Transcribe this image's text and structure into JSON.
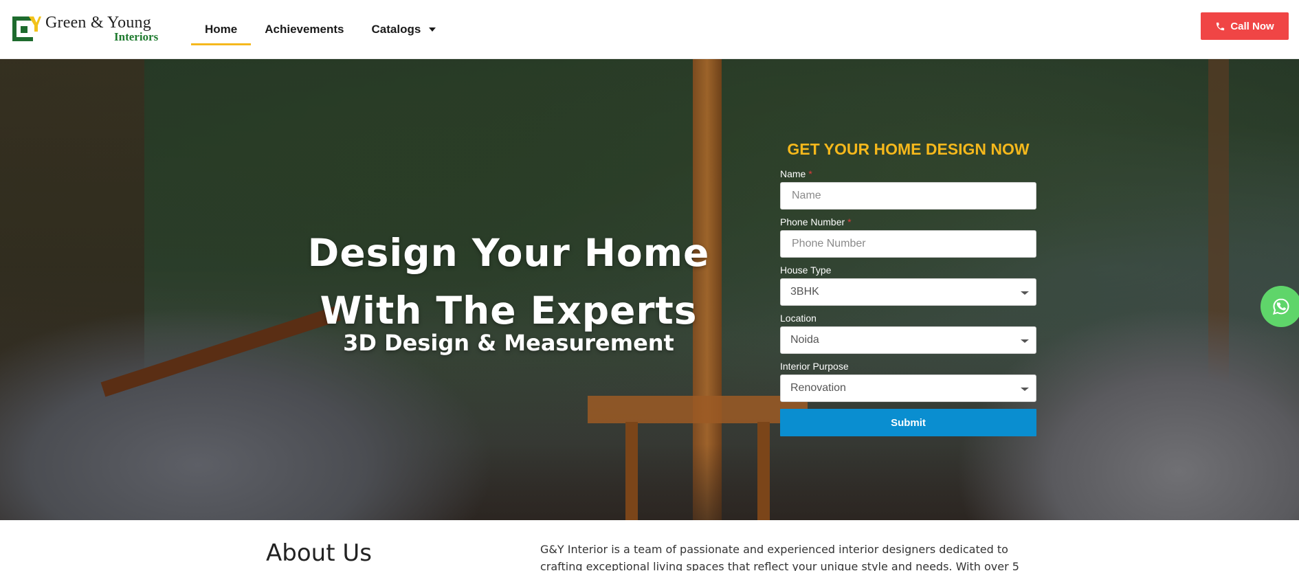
{
  "header": {
    "logo": {
      "mark": "G&Y",
      "brand": "Green & Young",
      "sub": "Interiors"
    },
    "nav": [
      {
        "label": "Home",
        "active": true
      },
      {
        "label": "Achievements",
        "active": false
      },
      {
        "label": "Catalogs",
        "active": false,
        "has_dropdown": true
      }
    ],
    "call_button": {
      "label": "Call Now",
      "icon": "phone-icon",
      "color": "#f04545"
    }
  },
  "hero": {
    "title_line1": "Design Your Home",
    "title_line2": "With The Experts",
    "subtitle": "3D Design & Measurement"
  },
  "form": {
    "title": "GET YOUR HOME DESIGN NOW",
    "title_color": "#f5b81c",
    "fields": {
      "name": {
        "label": "Name",
        "placeholder": "Name",
        "required": true
      },
      "phone": {
        "label": "Phone Number",
        "placeholder": "Phone Number",
        "required": true
      },
      "house_type": {
        "label": "House Type",
        "value": "3BHK"
      },
      "location": {
        "label": "Location",
        "value": "Noida"
      },
      "purpose": {
        "label": "Interior Purpose",
        "value": "Renovation"
      }
    },
    "submit_label": "Submit",
    "submit_color": "#0a8ed0"
  },
  "floating": {
    "whatsapp_icon": "whatsapp-icon"
  },
  "about": {
    "title": "About Us",
    "text": "G&Y Interior is a team of passionate and experienced interior designers dedicated to crafting exceptional living spaces that reflect your unique style and needs. With over 5"
  }
}
